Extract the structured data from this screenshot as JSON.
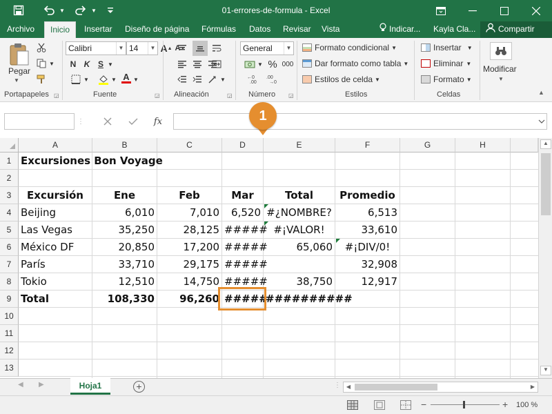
{
  "title_bar": {
    "document_title": "01-errores-de-formula  -  Excel",
    "qat_icons": [
      "save-icon",
      "undo-icon",
      "redo-icon",
      "customize-icon"
    ],
    "window_icons": [
      "ribbon-display-icon",
      "minimize-icon",
      "maximize-icon",
      "close-icon"
    ]
  },
  "tabs": [
    {
      "label": "Archivo"
    },
    {
      "label": "Inicio",
      "active": true
    },
    {
      "label": "Insertar"
    },
    {
      "label": "Diseño de página"
    },
    {
      "label": "Fórmulas"
    },
    {
      "label": "Datos"
    },
    {
      "label": "Revisar"
    },
    {
      "label": "Vista"
    }
  ],
  "tell_me": "Indicar...",
  "user_name": "Kayla Cla...",
  "share_label": "Compartir",
  "ribbon": {
    "clipboard": {
      "paste_label": "Pegar",
      "group_label": "Portapapeles"
    },
    "font": {
      "font_name": "Calibri",
      "font_size": "14",
      "bold": "N",
      "italic": "K",
      "underline": "S",
      "grow": "A",
      "shrink": "A",
      "font_color": "A",
      "group_label": "Fuente"
    },
    "alignment": {
      "group_label": "Alineación"
    },
    "number": {
      "format": "General",
      "currency": "$",
      "percent": "%",
      "thousands": "000",
      "group_label": "Número"
    },
    "styles": {
      "conditional": "Formato condicional",
      "as_table": "Dar formato como tabla",
      "cell_styles": "Estilos de celda",
      "group_label": "Estilos"
    },
    "cells": {
      "insert": "Insertar",
      "delete": "Eliminar",
      "format": "Formato",
      "group_label": "Celdas"
    },
    "editing": {
      "label": "Modificar"
    }
  },
  "formula_bar": {
    "name_box": "",
    "formula": "",
    "fx": "fx"
  },
  "callout": {
    "number": "1"
  },
  "accent_colors": {
    "excel_green": "#217346",
    "callout_orange": "#e58e2f",
    "error_indicator": "#1d7a3a"
  },
  "columns": [
    "A",
    "B",
    "C",
    "D",
    "E",
    "F",
    "G",
    "H"
  ],
  "rows": [
    "1",
    "2",
    "3",
    "4",
    "5",
    "6",
    "7",
    "8",
    "9",
    "10",
    "11",
    "12",
    "13"
  ],
  "sheet": {
    "title": "Excursiones Bon Voyage",
    "headers": {
      "name": "Excursión",
      "jan": "Ene",
      "feb": "Feb",
      "mar": "Mar",
      "total": "Total",
      "avg": "Promedio"
    },
    "data": [
      {
        "name": "Beijing",
        "jan": "6,010",
        "feb": "7,010",
        "mar": "6,520",
        "total": "#¿NOMBRE?",
        "avg": "6,513"
      },
      {
        "name": "Las Vegas",
        "jan": "35,250",
        "feb": "28,125",
        "mar": "#####",
        "total": "#¡VALOR!",
        "avg": "33,610"
      },
      {
        "name": "México DF",
        "jan": "20,850",
        "feb": "17,200",
        "mar": "#####",
        "total": "65,060",
        "avg": "#¡DIV/0!"
      },
      {
        "name": "París",
        "jan": "33,710",
        "feb": "29,175",
        "mar": "#####",
        "total": "",
        "avg": "32,908"
      },
      {
        "name": "Tokio",
        "jan": "12,510",
        "feb": "14,750",
        "mar": "#####",
        "total": "38,750",
        "avg": "12,917"
      }
    ],
    "totals": {
      "name": "Total",
      "jan": "108,330",
      "feb": "96,260",
      "mar": "#####",
      "total": "##########"
    }
  },
  "sheet_tab": "Hoja1",
  "zoom": "100 %"
}
